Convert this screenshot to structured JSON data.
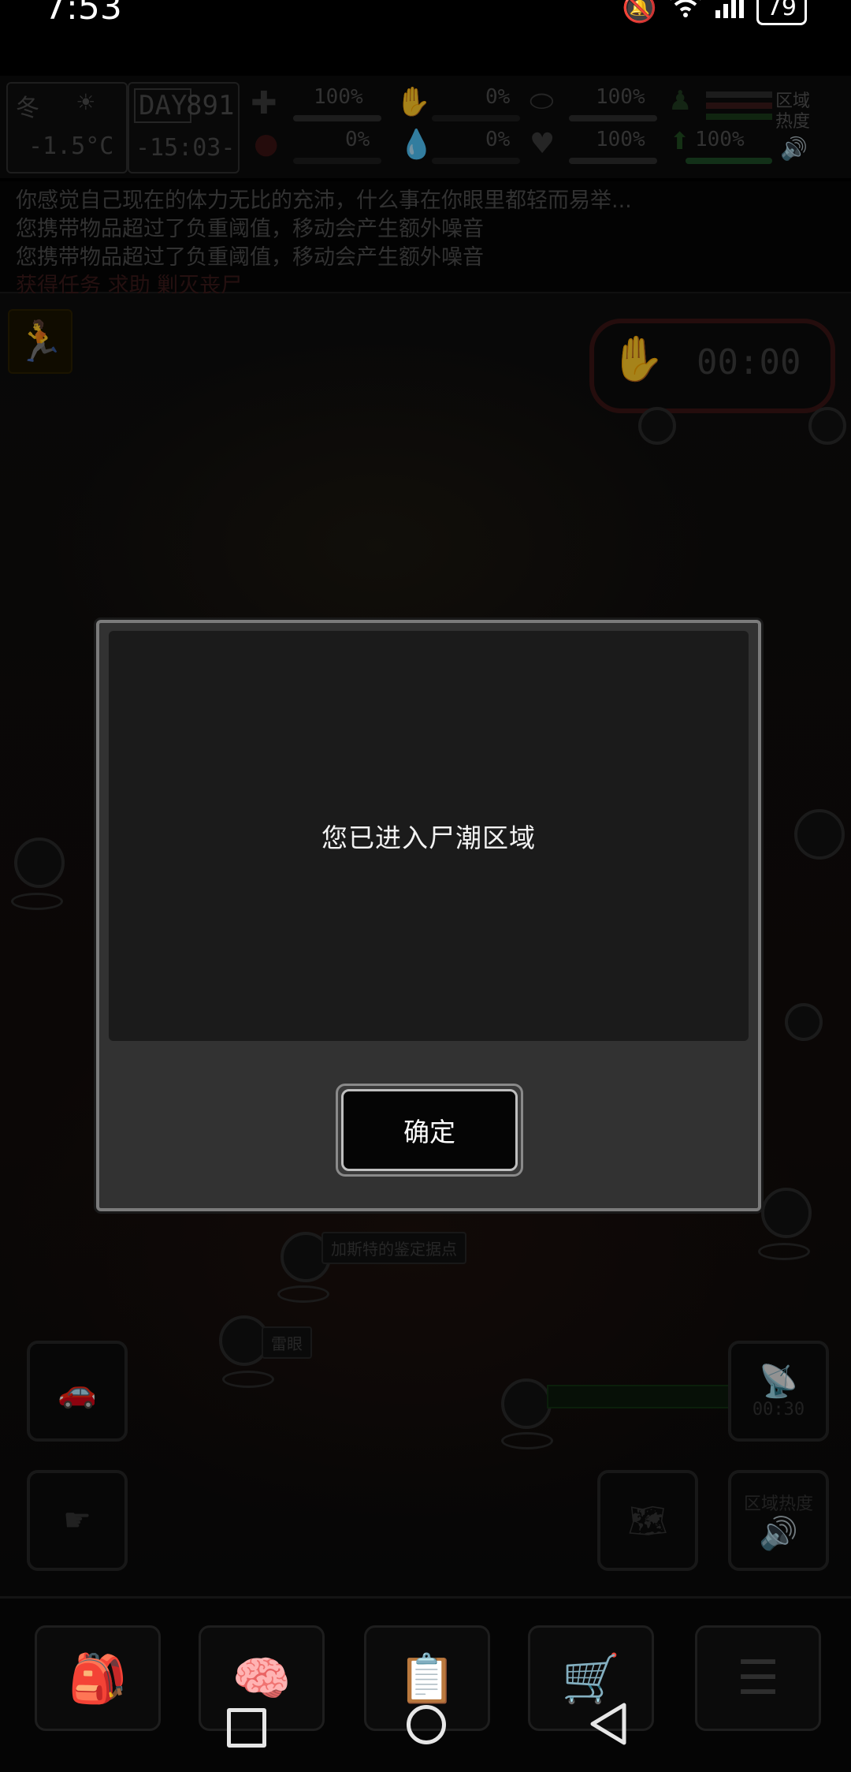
{
  "status_bar": {
    "time": "7:53",
    "battery": "79",
    "icons": [
      "bell-muted-icon",
      "wifi-icon",
      "signal-icon",
      "battery-icon"
    ]
  },
  "hud": {
    "season": "冬",
    "temperature": "-1.5°C",
    "day_label": "DAY",
    "day_number": "891",
    "clock": "-15:03-",
    "stats": [
      {
        "icon": "medkit-icon",
        "value": "100%"
      },
      {
        "icon": "blood-icon",
        "value": "0%"
      },
      {
        "icon": "stomach-icon",
        "value": "100%"
      },
      {
        "icon": "injury-icon",
        "value": "0%"
      },
      {
        "icon": "drop-icon",
        "value": "0%"
      },
      {
        "icon": "heart-icon",
        "value": "100%"
      },
      {
        "icon": "stamina-icon",
        "value": "100%"
      }
    ],
    "zone_heat_label": "区域热度"
  },
  "log": {
    "lines": [
      "你感觉自己现在的体力无比的充沛，什么事在你眼里都轻而易举...",
      "您携带物品超过了负重阈值，移动会产生额外噪音",
      "您携带物品超过了负重阈值，移动会产生额外噪音",
      "获得任务 求助 剿灭丧尸"
    ]
  },
  "map": {
    "timer": "00:00",
    "radar_timer": "00:30",
    "zone_heat_button": "区域热度",
    "labels": {
      "gas_station": "加斯特的鉴定据点",
      "thunder": "雷眼"
    }
  },
  "dialog": {
    "message": "您已进入尸潮区域",
    "confirm_label": "确定"
  },
  "bottom_menu": {
    "items": [
      "backpack-icon",
      "skills-icon",
      "notes-icon",
      "shop-cart-icon",
      "menu-list-icon"
    ]
  },
  "nav": {
    "items": [
      "recent-apps-icon",
      "home-icon",
      "back-icon"
    ]
  }
}
